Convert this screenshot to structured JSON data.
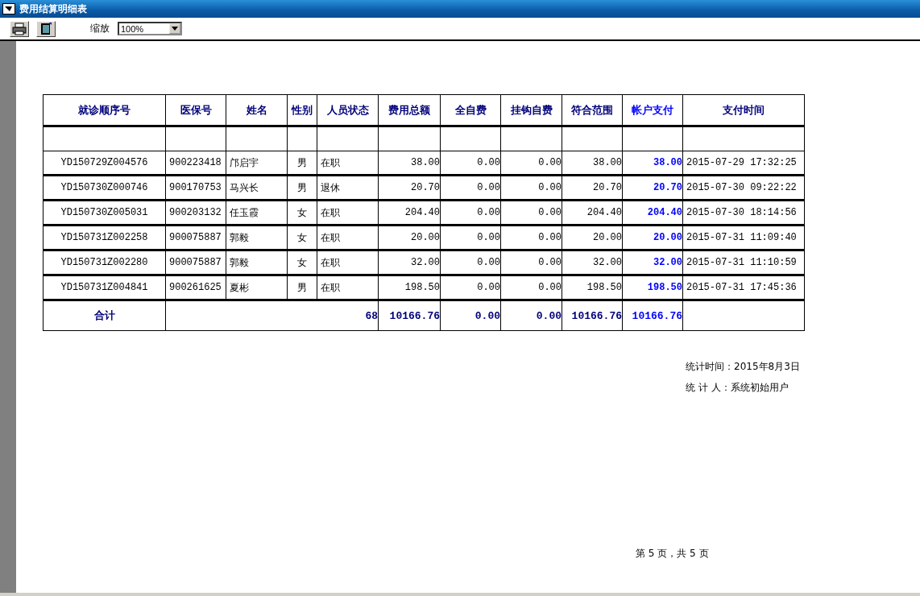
{
  "window": {
    "title": "费用结算明细表"
  },
  "toolbar": {
    "zoom_label": "缩放",
    "zoom_value": "100%"
  },
  "table": {
    "columns": [
      {
        "label": "就诊顺序号",
        "emphasis": false
      },
      {
        "label": "医保号",
        "emphasis": false
      },
      {
        "label": "姓名",
        "emphasis": false
      },
      {
        "label": "性别",
        "emphasis": false
      },
      {
        "label": "人员状态",
        "emphasis": false
      },
      {
        "label": "费用总额",
        "emphasis": false
      },
      {
        "label": "全自费",
        "emphasis": false
      },
      {
        "label": "挂钩自费",
        "emphasis": false
      },
      {
        "label": "符合范围",
        "emphasis": false
      },
      {
        "label": "帐户支付",
        "emphasis": true
      },
      {
        "label": "支付时间",
        "emphasis": false
      }
    ],
    "rows": [
      [
        "YD150729Z004576",
        "900223418",
        "邝启宇",
        "男",
        "在职",
        "38.00",
        "0.00",
        "0.00",
        "38.00",
        "38.00",
        "2015-07-29 17:32:25"
      ],
      [
        "YD150730Z000746",
        "900170753",
        "马兴长",
        "男",
        "退休",
        "20.70",
        "0.00",
        "0.00",
        "20.70",
        "20.70",
        "2015-07-30 09:22:22"
      ],
      [
        "YD150730Z005031",
        "900203132",
        "任玉霞",
        "女",
        "在职",
        "204.40",
        "0.00",
        "0.00",
        "204.40",
        "204.40",
        "2015-07-30 18:14:56"
      ],
      [
        "YD150731Z002258",
        "900075887",
        "郭毅",
        "女",
        "在职",
        "20.00",
        "0.00",
        "0.00",
        "20.00",
        "20.00",
        "2015-07-31 11:09:40"
      ],
      [
        "YD150731Z002280",
        "900075887",
        "郭毅",
        "女",
        "在职",
        "32.00",
        "0.00",
        "0.00",
        "32.00",
        "32.00",
        "2015-07-31 11:10:59"
      ],
      [
        "YD150731Z004841",
        "900261625",
        "夏彬",
        "男",
        "在职",
        "198.50",
        "0.00",
        "0.00",
        "198.50",
        "198.50",
        "2015-07-31 17:45:36"
      ]
    ],
    "total": {
      "label": "合计",
      "count": "68",
      "values": [
        "10166.76",
        "0.00",
        "0.00",
        "10166.76",
        "10166.76"
      ]
    }
  },
  "report_footer": {
    "stat_time": "统计时间：2015年8月3日",
    "stat_person": "统 计 人：系统初始用户",
    "page": "第 5 页，共 5 页"
  }
}
